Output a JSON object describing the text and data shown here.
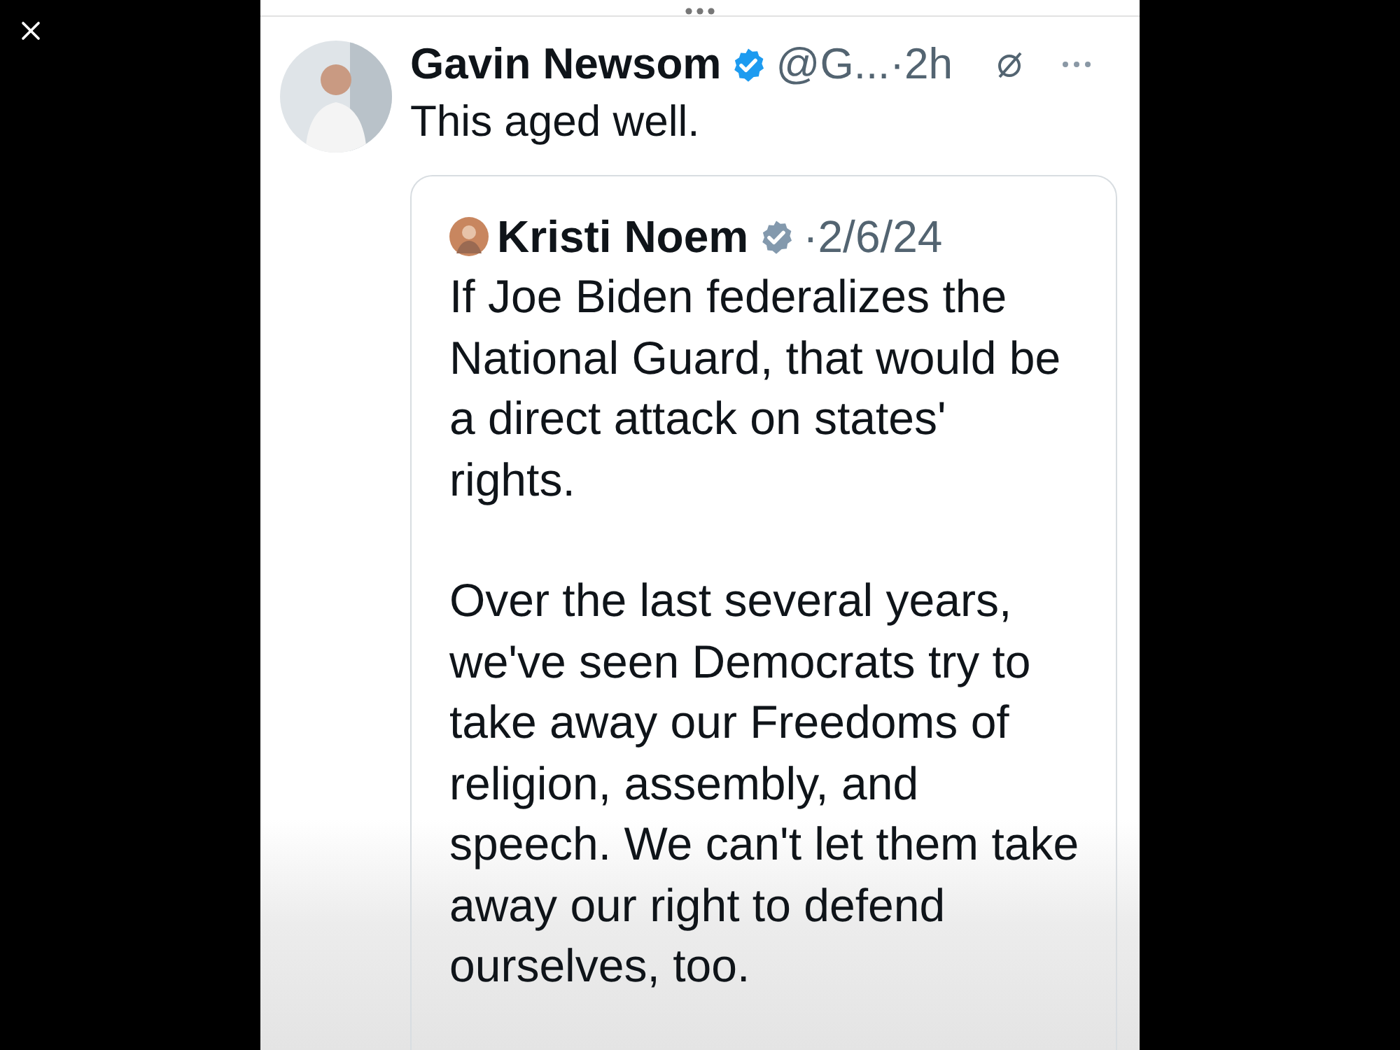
{
  "tweet": {
    "author": {
      "name": "Gavin Newsom",
      "verified": true,
      "meta": "@G...·2h"
    },
    "text": "This aged well.",
    "quoted_tweet": {
      "author": {
        "name": "Kristi Noem",
        "verified": true,
        "meta": "·2/6/24"
      },
      "paragraphs": [
        "If Joe Biden federalizes the National Guard, that would be a direct attack on states' rights.",
        "Over the last several years, we've seen Democrats try to take away our Freedoms of religion, assembly, and speech. We can't let them take away our right to defend ourselves, too."
      ]
    }
  }
}
